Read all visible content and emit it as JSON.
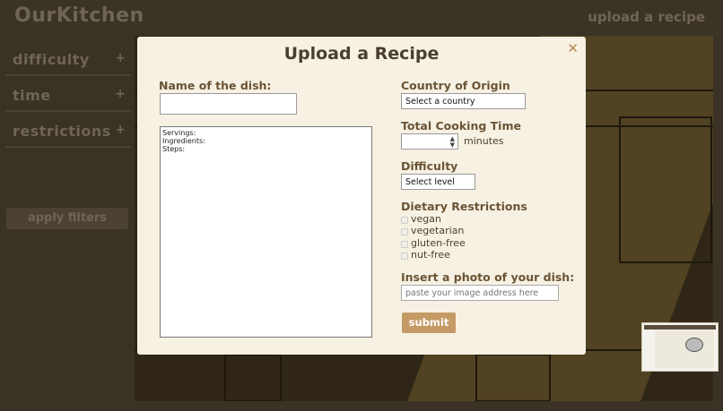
{
  "app": {
    "logo": "OurKitchen",
    "upload_link": "upload a recipe"
  },
  "sidebar": {
    "filters": [
      {
        "label": "difficulty",
        "toggle": "+"
      },
      {
        "label": "time",
        "toggle": "+"
      },
      {
        "label": "restrictions",
        "toggle": "+"
      }
    ],
    "apply_label": "apply filters"
  },
  "modal": {
    "title": "Upload a Recipe",
    "close_glyph": "✕",
    "dish_name": {
      "label": "Name of the dish:",
      "value": ""
    },
    "recipe_text": {
      "value": "Servings:\nIngredients:\nSteps:"
    },
    "country": {
      "label": "Country of Origin",
      "selected": "Select a country"
    },
    "cooking_time": {
      "label": "Total Cooking Time",
      "value": "",
      "units": "minutes"
    },
    "difficulty": {
      "label": "Difficulty",
      "selected": "Select level"
    },
    "dietary": {
      "label": "Dietary Restrictions",
      "options": [
        {
          "label": "vegan",
          "checked": false
        },
        {
          "label": "vegetarian",
          "checked": false
        },
        {
          "label": "gluten-free",
          "checked": false
        },
        {
          "label": "nut-free",
          "checked": false
        }
      ]
    },
    "photo": {
      "label": "Insert a photo of your dish:",
      "placeholder": "paste your image address here"
    },
    "submit_label": "submit"
  },
  "colors": {
    "accent": "#c49a67",
    "modal_bg": "#f7f1e3",
    "heading": "#6b5434",
    "overlay": "#3a3224"
  }
}
